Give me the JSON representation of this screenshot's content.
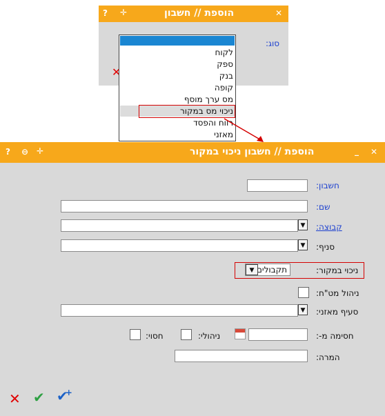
{
  "top_dialog": {
    "title": "הוספת // חשבון",
    "title_icons": [
      "close-icon",
      "plus-icon",
      "help-icon"
    ],
    "type_label": "סוג:",
    "dropdown_items": [
      "",
      "לקוח",
      "ספק",
      "בנק",
      "קופה",
      "מס ערך מוסף",
      "ניכוי מס במקור",
      "רווח והפסד",
      "מאזני"
    ],
    "highlighted_item": "ניכוי מס במקור"
  },
  "main_dialog": {
    "title": "הוספת // חשבון ניכוי במקור",
    "labels": {
      "account": "חשבון:",
      "name": "שם:",
      "group": "קבוצה:",
      "branch": "סניף:",
      "withholding": "ניכוי במקור:",
      "fx_manage": "ניהול מט\"ח:",
      "balance_section": "סעיף מאזני:",
      "block_from": "חסימה מ-:",
      "managed": "ניהולי:",
      "blocked": "חסוי:",
      "note": "המרה:"
    },
    "values": {
      "account": "",
      "name": "",
      "group": "",
      "branch": "",
      "withholding": "תקבולים",
      "balance_section": "",
      "block_from": "",
      "note": ""
    },
    "footer_icons": [
      "cancel-icon",
      "confirm-icon",
      "confirm-and-add-icon"
    ]
  },
  "colors": {
    "title_bar": "#f7a81b",
    "dialog_bg": "#d9d9d9",
    "label_blue": "#1b3fcf",
    "highlight_red": "#d40000",
    "selection_blue": "#1a86d2",
    "confirm_green": "#2ea043",
    "cancel_red": "#e00000",
    "confirm_add_blue": "#1b61c7"
  }
}
